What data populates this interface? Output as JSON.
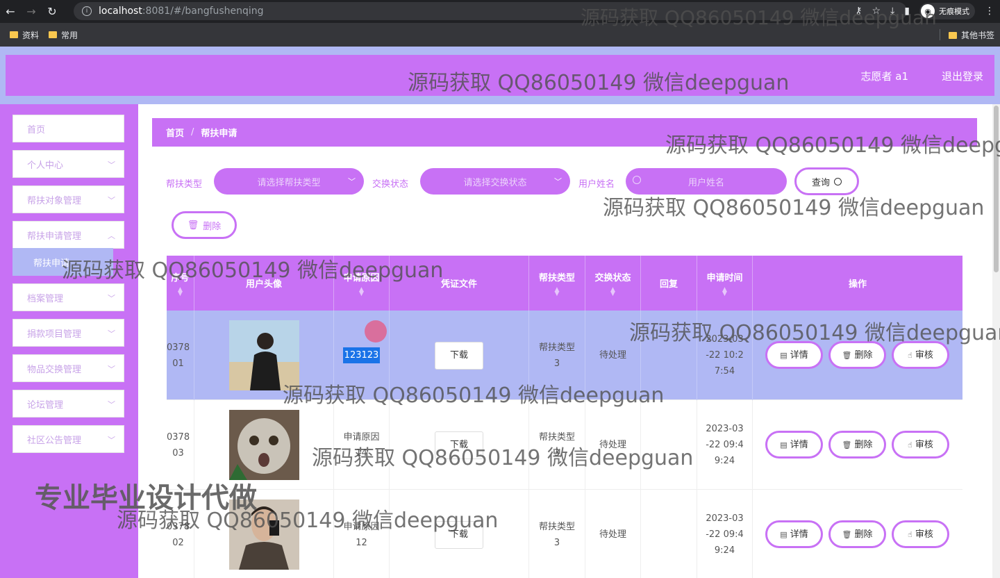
{
  "browser": {
    "url_host": "localhost",
    "url_rest": ":8081/#/bangfushenqing",
    "incognito_label": "无痕模式",
    "bookmarks": [
      "资料",
      "常用"
    ],
    "other_bookmarks": "其他书签"
  },
  "header": {
    "title": "",
    "user": "志愿者 a1",
    "logout": "退出登录"
  },
  "sidebar": {
    "items": [
      {
        "label": "首页"
      },
      {
        "label": "个人中心"
      },
      {
        "label": "帮扶对象管理"
      },
      {
        "label": "帮扶申请管理"
      },
      {
        "label": "档案管理"
      },
      {
        "label": "捐款项目管理"
      },
      {
        "label": "物品交换管理"
      },
      {
        "label": "论坛管理"
      },
      {
        "label": "社区公告管理"
      }
    ],
    "active_sub": "帮扶申请"
  },
  "breadcrumb": {
    "home": "首页",
    "sep": "/",
    "current": "帮扶申请"
  },
  "filters": {
    "type_label": "帮扶类型",
    "type_placeholder": "请选择帮扶类型",
    "status_label": "交换状态",
    "status_placeholder": "请选择交换状态",
    "name_label": "用户姓名",
    "name_placeholder": "用户姓名",
    "query_btn": "查询",
    "delete_btn": "删除"
  },
  "table": {
    "headers": [
      "序号",
      "用户头像",
      "申请原因",
      "凭证文件",
      "帮扶类型",
      "交换状态",
      "回复",
      "申请时间",
      "操作"
    ],
    "download": "下载",
    "actions": {
      "detail": "详情",
      "delete": "删除",
      "review": "审核"
    },
    "rows": [
      {
        "id": "0378\n01",
        "reason": "123123",
        "type": "帮扶类型\n3",
        "status": "待处理",
        "reply": "",
        "time": "2023-03\n-22 10:2\n7:54"
      },
      {
        "id": "0378\n03",
        "reason": "申请原因\n14",
        "type": "帮扶类型\n3",
        "status": "待处理",
        "reply": "",
        "time": "2023-03\n-22 09:4\n9:24"
      },
      {
        "id": "0378\n02",
        "reason": "申请原因\n12",
        "type": "帮扶类型\n3",
        "status": "待处理",
        "reply": "",
        "time": "2023-03\n-22 09:4\n9:24"
      }
    ]
  },
  "watermarks": {
    "text": "源码获取 QQ86050149 微信deepguan",
    "big": "专业毕业设计代做"
  },
  "colors": {
    "accent": "#c871f5",
    "secondary": "#b0b8f4"
  }
}
